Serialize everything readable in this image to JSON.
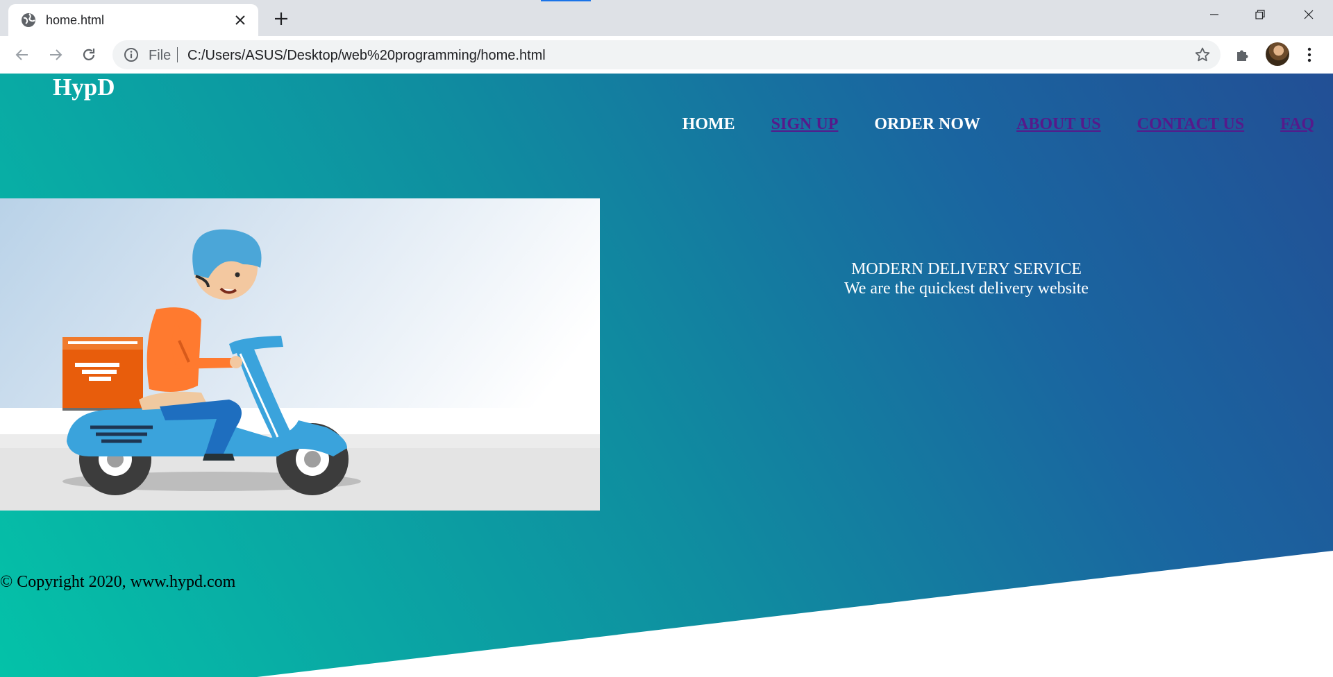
{
  "browser": {
    "tab_title": "home.html",
    "omnibox_scheme_label": "File",
    "url": "C:/Users/ASUS/Desktop/web%20programming/home.html"
  },
  "site": {
    "logo": "HypD",
    "nav": [
      {
        "label": "HOME",
        "state": "plain"
      },
      {
        "label": "SIGN UP",
        "state": "visited-link"
      },
      {
        "label": "ORDER NOW",
        "state": "plain"
      },
      {
        "label": "ABOUT US",
        "state": "visited-link"
      },
      {
        "label": "CONTACT US",
        "state": "visited-link"
      },
      {
        "label": "FAQ",
        "state": "visited-link"
      }
    ],
    "hero": {
      "headline": "MODERN DELIVERY SERVICE",
      "tagline": "We are the quickest delivery website"
    },
    "footer": {
      "copyright": "© Copyright 2020, www.hypd.com"
    }
  },
  "colors": {
    "gradient_start": "#04c2a8",
    "gradient_end": "#224f95",
    "visited_link": "#551a8b",
    "scooter_box": "#e85d0c",
    "scooter_body": "#3aa3dc"
  }
}
